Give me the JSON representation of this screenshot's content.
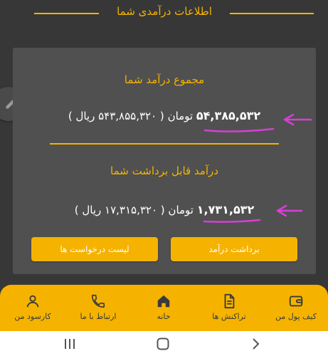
{
  "section": {
    "title": "اطلاعات درآمدی شما"
  },
  "income": {
    "total_title": "مجموع درآمد شما",
    "total_toman": "۵۴,۳۸۵,۵۳۲",
    "total_toman_unit": "تومان",
    "total_rial": "( ۵۴۳,۸۵۵,۳۲۰ ریال )",
    "withdrawable_title": "درآمد قابل برداشت شما",
    "withdrawable_toman": "۱,۷۳۱,۵۳۲",
    "withdrawable_toman_unit": "تومان",
    "withdrawable_rial": "( ۱۷,۳۱۵,۳۲۰ ریال )"
  },
  "actions": {
    "withdraw_label": "برداشت درآمد",
    "requests_label": "لیست درخواست ها"
  },
  "nav": {
    "items": [
      {
        "label": "کیف پول من",
        "icon": "wallet-icon"
      },
      {
        "label": "تراکنش ها",
        "icon": "document-icon"
      },
      {
        "label": "خانه",
        "icon": "home-icon"
      },
      {
        "label": "ارتباط با ما",
        "icon": "phone-icon"
      },
      {
        "label": "کارسود من",
        "icon": "user-icon"
      }
    ]
  },
  "colors": {
    "accent": "#f4b400",
    "background": "#373737",
    "card": "#505050",
    "annotation": "#d63fd6"
  }
}
